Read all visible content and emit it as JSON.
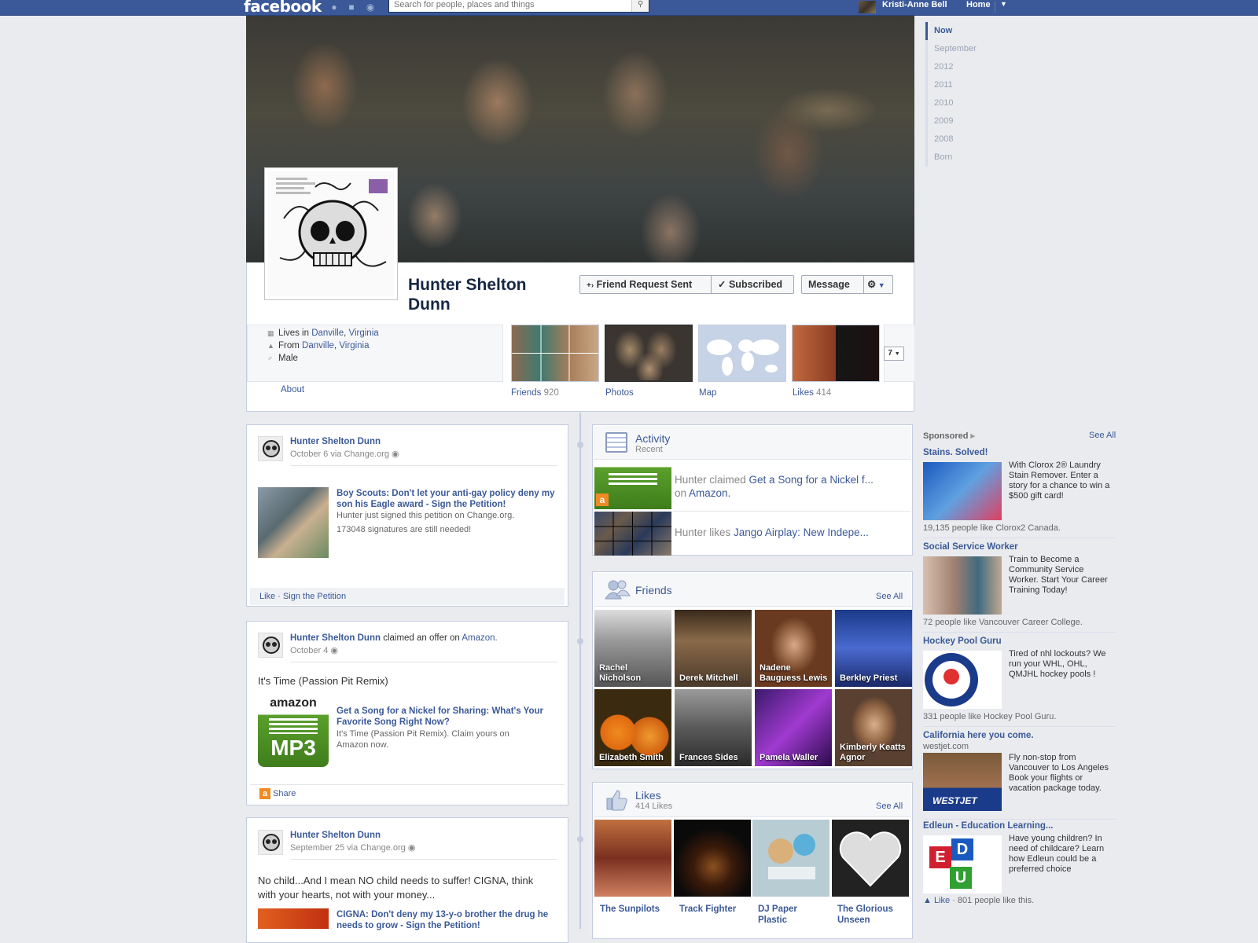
{
  "topbar": {
    "logo": "facebook",
    "search_placeholder": "Search for people, places and things",
    "user_name": "Kristi-Anne Bell",
    "home": "Home"
  },
  "profile": {
    "name": "Hunter Shelton Dunn",
    "buttons": {
      "friend_request": "Friend Request Sent",
      "subscribed": "Subscribed",
      "message": "Message"
    },
    "info": [
      {
        "prefix": "Lives in ",
        "city": "Danville",
        "sep": ", ",
        "region": "Virginia"
      },
      {
        "prefix": "From ",
        "city": "Danville",
        "sep": ", ",
        "region": "Virginia"
      },
      {
        "text": "Male"
      }
    ],
    "about": "About",
    "tabs": [
      {
        "label": "Friends",
        "count": "920"
      },
      {
        "label": "Photos",
        "count": ""
      },
      {
        "label": "Map",
        "count": ""
      },
      {
        "label": "Likes",
        "count": "414"
      }
    ],
    "more_count": "7"
  },
  "timeline_nav": [
    "Now",
    "September",
    "2012",
    "2011",
    "2010",
    "2009",
    "2008",
    "Born"
  ],
  "stories": [
    {
      "author": "Hunter Shelton Dunn",
      "meta": "October 6 via Change.org",
      "attach_title": "Boy Scouts: Don't let your anti-gay policy deny my son his Eagle award - Sign the Petition!",
      "attach_desc1": "Hunter just signed this petition on Change.org.",
      "attach_desc2": "173048 signatures are still needed!",
      "footer": "Like · Sign the Petition"
    },
    {
      "author": "Hunter Shelton Dunn",
      "action": " claimed an offer on ",
      "action_link": "Amazon.",
      "meta": "October 4",
      "text": "It's Time (Passion Pit Remix)",
      "attach_title": "Get a Song for a Nickel for Sharing: What's Your Favorite Song Right Now?",
      "attach_desc": "It's Time (Passion Pit Remix). Claim yours on Amazon now.",
      "footer": "Share",
      "amazon_logo": "amazon",
      "mp3": "MP3"
    },
    {
      "author": "Hunter Shelton Dunn",
      "meta": "September 25 via Change.org",
      "text": "No child...And I mean NO child needs to suffer! CIGNA, think with your hearts, not with your money...",
      "attach_title": "CIGNA: Don't deny my 13-y-o brother the drug he needs to grow - Sign the Petition!"
    }
  ],
  "activity": {
    "title": "Activity",
    "sub": "Recent",
    "items": [
      {
        "prefix": "Hunter claimed ",
        "link": "Get a Song for a Nickel f...",
        "line2_prefix": "on ",
        "line2_link": "Amazon."
      },
      {
        "prefix": "Hunter likes ",
        "link": "Jango Airplay: New Indepe..."
      }
    ]
  },
  "friends_box": {
    "title": "Friends",
    "see_all": "See All",
    "friends": [
      "Rachel Nicholson",
      "Derek Mitchell",
      "Nadene Bauguess Lewis",
      "Berkley Priest",
      "Elizabeth Smith",
      "Frances Sides",
      "Pamela Waller",
      "Kimberly Keatts Agnor"
    ]
  },
  "likes_box": {
    "title": "Likes",
    "sub": "414 Likes",
    "see_all": "See All",
    "likes": [
      "The Sunpilots",
      "Track Fighter",
      "DJ Paper Plastic",
      "The Glorious Unseen"
    ]
  },
  "sponsored": {
    "header": "Sponsored",
    "see_all": "See All",
    "ads": [
      {
        "title": "Stains. Solved!",
        "text": "With Clorox 2® Laundry Stain Remover. Enter a story for a chance to win a $500 gift card!",
        "meta": "19,135 people like Clorox2 Canada."
      },
      {
        "title": "Social Service Worker",
        "text": "Train to Become a Community Service Worker. Start Your Career Training Today!",
        "meta": "72 people like Vancouver Career College."
      },
      {
        "title": "Hockey Pool Guru",
        "text": "Tired of nhl lockouts? We run your WHL, OHL, QMJHL hockey pools !",
        "meta": "331 people like Hockey Pool Guru."
      },
      {
        "title": "California here you come.",
        "domain": "westjet.com",
        "text": "Fly non-stop from Vancouver to Los Angeles Book your flights or vacation package today.",
        "img_text": "WESTJET"
      },
      {
        "title": "Edleun - Education Learning...",
        "text": "Have young children? In need of childcare? Learn how Edleun could be a preferred choice",
        "like": "Like",
        "meta": " · 801 people like this.",
        "letters": [
          "E",
          "D",
          "U"
        ]
      }
    ]
  },
  "colors": {
    "brand": "#3b5998",
    "background": "#e9ebee",
    "amazon_green": "#5aa02c"
  }
}
